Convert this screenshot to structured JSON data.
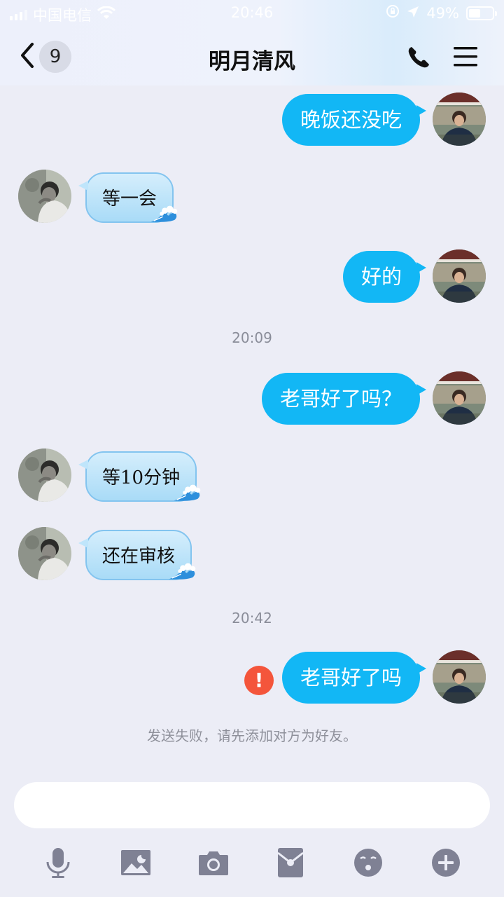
{
  "status_bar": {
    "carrier": "中国电信",
    "time": "20:46",
    "battery_percent": "49%",
    "battery_level": 0.49,
    "icons": [
      "signal-icon",
      "wifi-icon",
      "rotation-lock-icon",
      "location-arrow-icon",
      "battery-icon"
    ]
  },
  "nav": {
    "unread_count": "9",
    "title": "明月清风",
    "icons": [
      "back-chevron-icon",
      "phone-icon",
      "menu-icon"
    ]
  },
  "messages": [
    {
      "side": "right",
      "text": "晚饭还没吃"
    },
    {
      "side": "left",
      "text": "等一会"
    },
    {
      "side": "right",
      "text": "好的"
    },
    {
      "type": "time",
      "text": "20:09"
    },
    {
      "side": "right",
      "text": "老哥好了吗？"
    },
    {
      "side": "left",
      "text": "等10分钟"
    },
    {
      "side": "left",
      "text": "还在审核"
    },
    {
      "type": "time",
      "text": "20:42"
    },
    {
      "side": "right",
      "text": "老哥好了吗",
      "status": "failed"
    }
  ],
  "failure_notice": "发送失败，请先添加对方为好友。",
  "input": {
    "value": "",
    "placeholder": ""
  },
  "toolbar": [
    "microphone-icon",
    "image-icon",
    "camera-icon",
    "red-packet-icon",
    "emoji-icon",
    "plus-icon"
  ],
  "colors": {
    "sent_bubble": "#12b7f5",
    "received_bubble": "#b9e2fa",
    "error": "#f4553b",
    "background": "#ecedf6",
    "toolbar_icon": "#7f8194"
  }
}
